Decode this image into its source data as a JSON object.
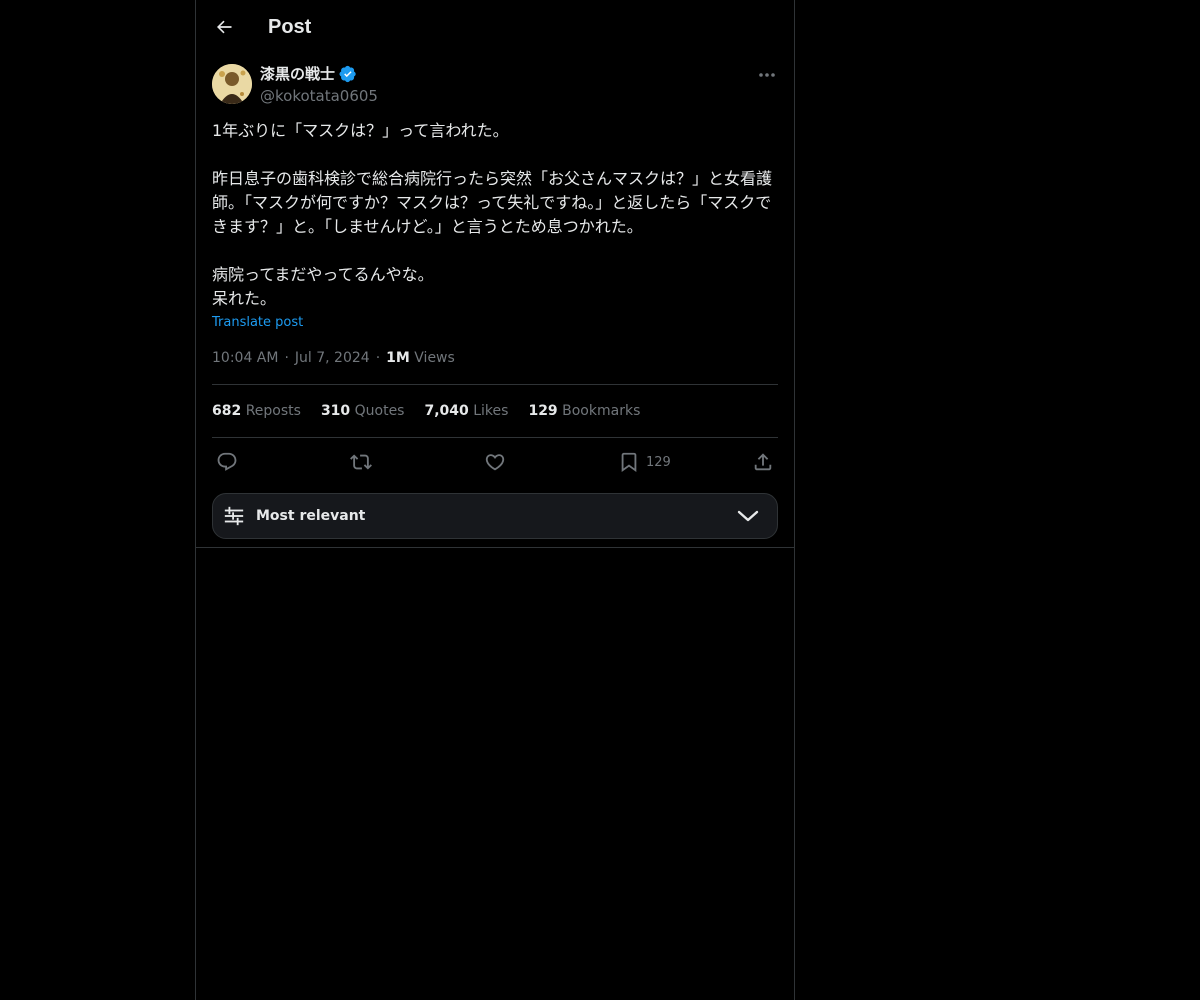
{
  "header": {
    "title": "Post"
  },
  "author": {
    "display_name": "漆黒の戦士",
    "handle": "@kokotata0605",
    "verified": true
  },
  "tweet": {
    "text": "1年ぶりに「マスクは？」って言われた。\n\n昨日息子の歯科検診で総合病院行ったら突然「お父さんマスクは？」と女看護師。「マスクが何ですか？マスクは？って失礼ですね。」と返したら「マスクできます？」と。「しませんけど。」と言うとため息つかれた。\n\n病院ってまだやってるんやな。\n呆れた。",
    "translate_label": "Translate post",
    "time": "10:04 AM",
    "date": "Jul 7, 2024",
    "views_count": "1M",
    "views_label": "Views"
  },
  "stats": {
    "reposts_count": "682",
    "reposts_label": "Reposts",
    "quotes_count": "310",
    "quotes_label": "Quotes",
    "likes_count": "7,040",
    "likes_label": "Likes",
    "bookmarks_count": "129",
    "bookmarks_label": "Bookmarks"
  },
  "actions": {
    "bookmark_count": "129"
  },
  "sort": {
    "label": "Most relevant"
  },
  "colors": {
    "background": "#000000",
    "text": "#e7e9ea",
    "secondary": "#71767b",
    "accent": "#1d9bf0",
    "border": "#2f3336"
  },
  "icons": [
    "back-arrow-icon",
    "verified-badge-icon",
    "more-icon",
    "reply-icon",
    "repost-icon",
    "like-icon",
    "bookmark-icon",
    "share-icon",
    "sliders-icon",
    "chevron-down-icon"
  ]
}
